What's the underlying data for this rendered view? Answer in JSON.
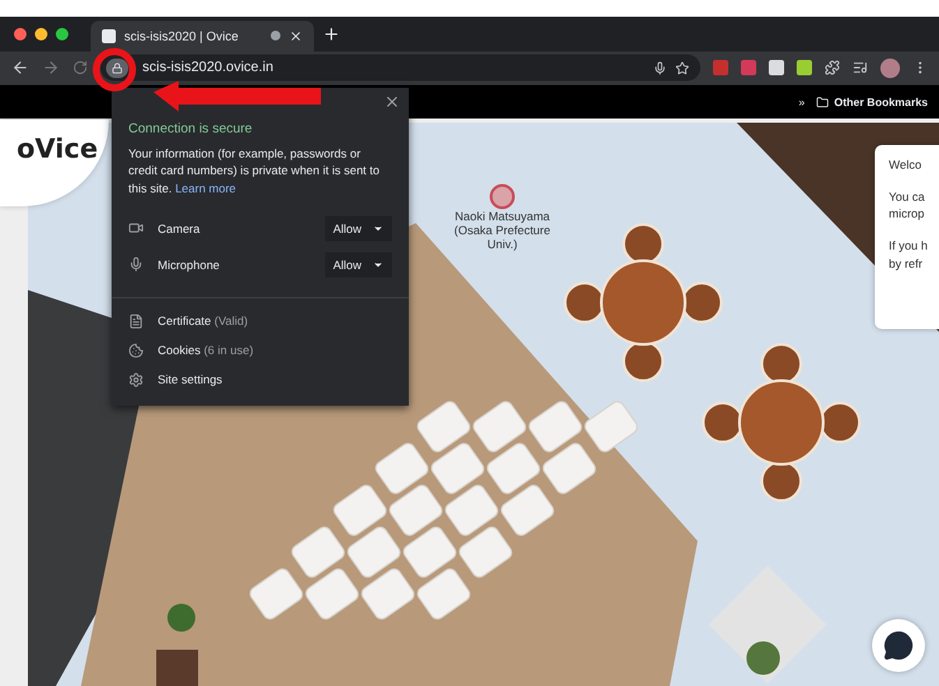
{
  "tabs": [
    {
      "title": "scis-isis2020 | Ovice",
      "selected": true
    }
  ],
  "address": {
    "url": "scis-isis2020.ovice.in"
  },
  "bookmarks": {
    "overflow": "»",
    "items": [
      {
        "label": "Other Bookmarks"
      }
    ]
  },
  "site_info": {
    "title": "Connection is secure",
    "body": "Your information (for example, passwords or credit card numbers) is private when it is sent to this site.",
    "link": "Learn more",
    "permissions": [
      {
        "kind": "camera",
        "label": "Camera",
        "value": "Allow"
      },
      {
        "kind": "microphone",
        "label": "Microphone",
        "value": "Allow"
      }
    ],
    "links": [
      {
        "kind": "certificate",
        "label": "Certificate",
        "note": "(Valid)"
      },
      {
        "kind": "cookies",
        "label": "Cookies",
        "note": "(6 in use)"
      },
      {
        "kind": "settings",
        "label": "Site settings"
      }
    ]
  },
  "app": {
    "logo": "oVice",
    "user": {
      "name": "Naoki Matsuyama",
      "affiliation": "(Osaka Prefecture Univ.)"
    },
    "welcome": [
      [
        "Welco"
      ],
      [
        "You ca",
        "microp"
      ],
      [
        "If you h",
        "by refr"
      ]
    ]
  }
}
